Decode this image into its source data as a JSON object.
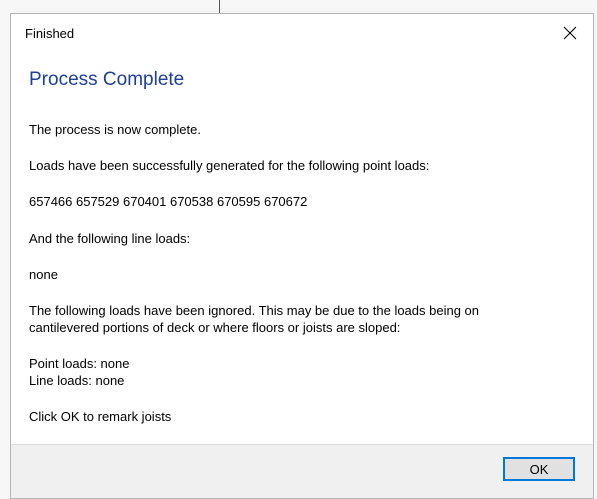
{
  "dialog": {
    "title": "Finished",
    "close_icon": "close-icon",
    "heading": "Process Complete",
    "lines": {
      "complete": "The process is now complete.",
      "point_intro": "Loads have been successfully generated for the following point loads:",
      "point_ids": "657466 657529 670401 670538 670595 670672",
      "line_intro": "And the following line loads:",
      "line_value": "none",
      "ignored_1": "The following loads have been ignored. This may be due to the loads being on",
      "ignored_2": "cantilevered portions of deck or where floors or joists are sloped:",
      "ignored_point": "Point loads: none",
      "ignored_line": "Line loads: none",
      "prompt": "Click OK to remark joists"
    },
    "ok_label": "OK"
  },
  "colors": {
    "heading": "#1e3f9a",
    "button_border": "#0078d7",
    "footer": "#f0f0f0"
  }
}
